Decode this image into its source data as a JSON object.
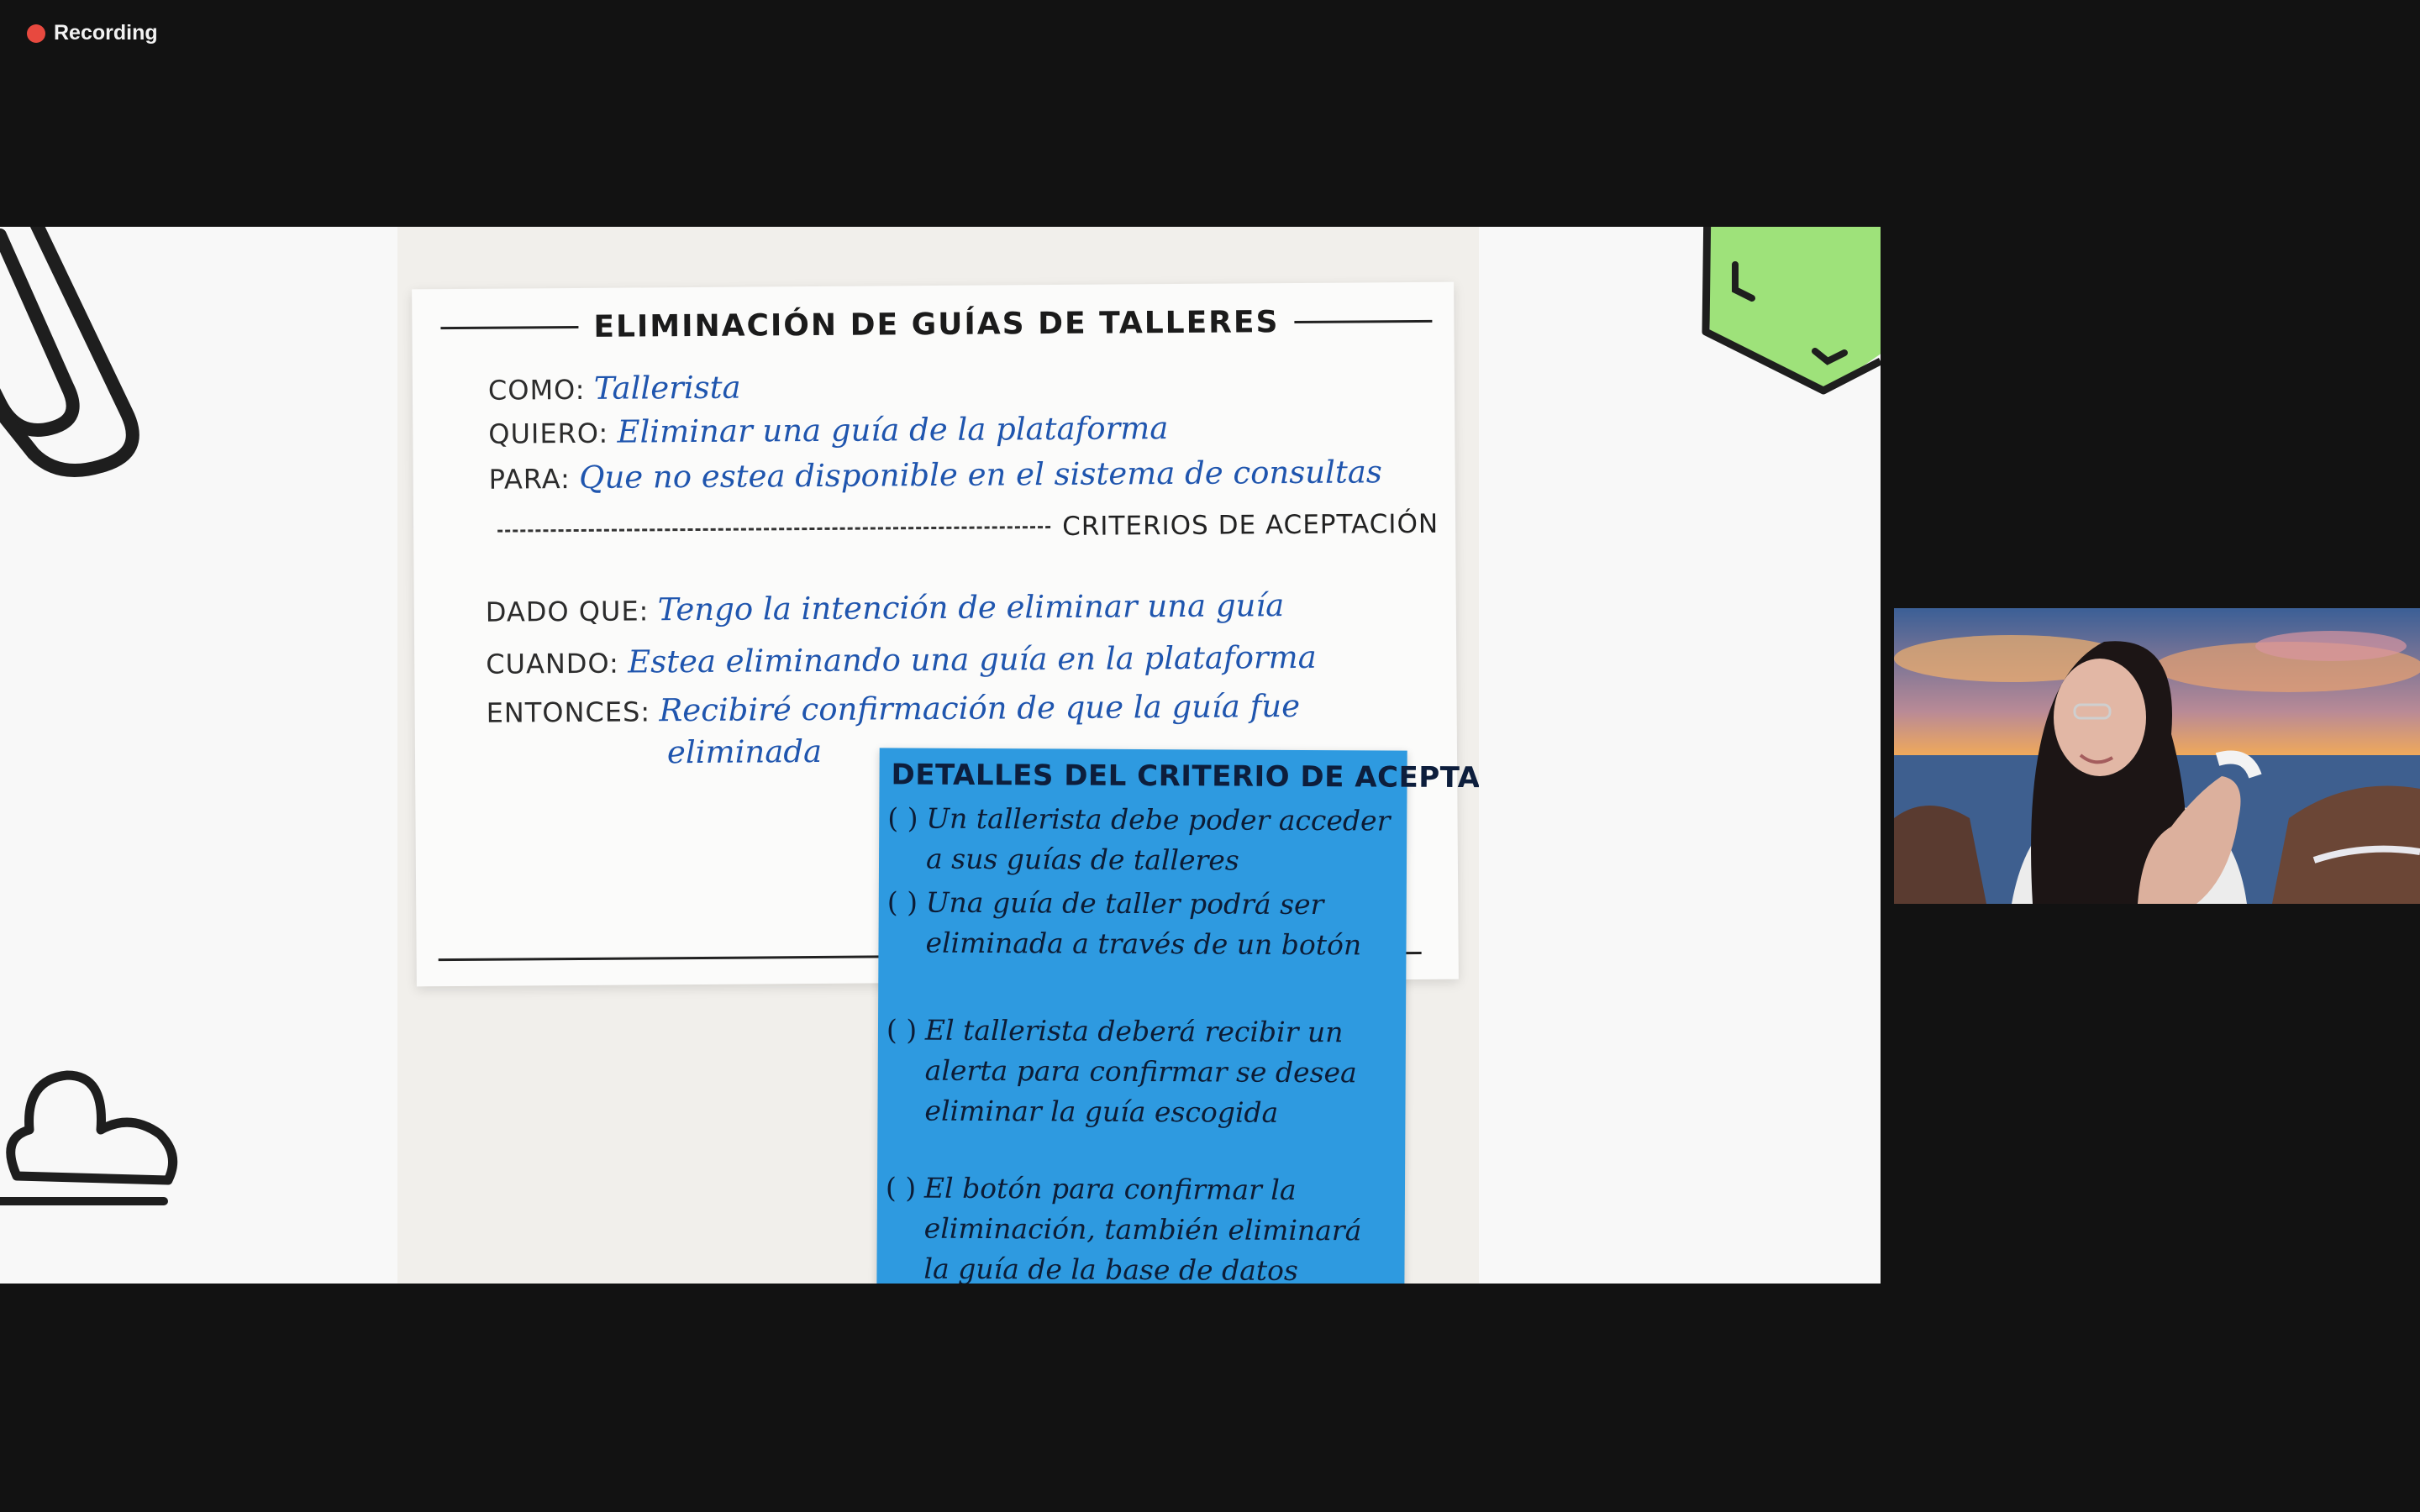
{
  "recording": {
    "label": "Recording"
  },
  "share": {
    "card": {
      "title": "ELIMINACIÓN DE GUÍAS DE TALLERES",
      "story": [
        {
          "key": "COMO:",
          "value": "Tallerista"
        },
        {
          "key": "QUIERO:",
          "value": "Eliminar una guía de la plataforma"
        },
        {
          "key": "PARA:",
          "value": "Que no estea disponible en el sistema de consultas"
        }
      ],
      "criteria_title": "CRITERIOS DE ACEPTACIÓN",
      "criteria": [
        {
          "key": "DADO QUE:",
          "value": "Tengo la intención de eliminar una guía"
        },
        {
          "key": "CUANDO:",
          "value": "Estea eliminando una guía en la plataforma"
        },
        {
          "key": "ENTONCES:",
          "value": "Recibiré confirmación de que la guía fue",
          "value_cont": "eliminada"
        }
      ]
    },
    "sticky": {
      "title": "DETALLES DEL CRITERIO DE ACEPTACIÓN",
      "box": "( )",
      "items": [
        "Un tallerista debe poder acceder a sus guías de talleres",
        "Una guía de taller podrá ser eliminada a través de un botón",
        "El tallerista deberá recibir un alerta para confirmar se desea eliminar la guía escogida",
        "El botón para confirmar la eliminación, también eliminará la guía de la base de datos"
      ]
    }
  },
  "colors": {
    "background": "#121212",
    "recording_dot": "#e8493f",
    "sticky": "#2e9ae0",
    "ink_blue": "#1f55ae",
    "hexagon": "#9ee27a"
  },
  "icons": [
    "recording-dot-icon",
    "paperclip-icon",
    "hexagon-icon",
    "cloud-icon"
  ]
}
